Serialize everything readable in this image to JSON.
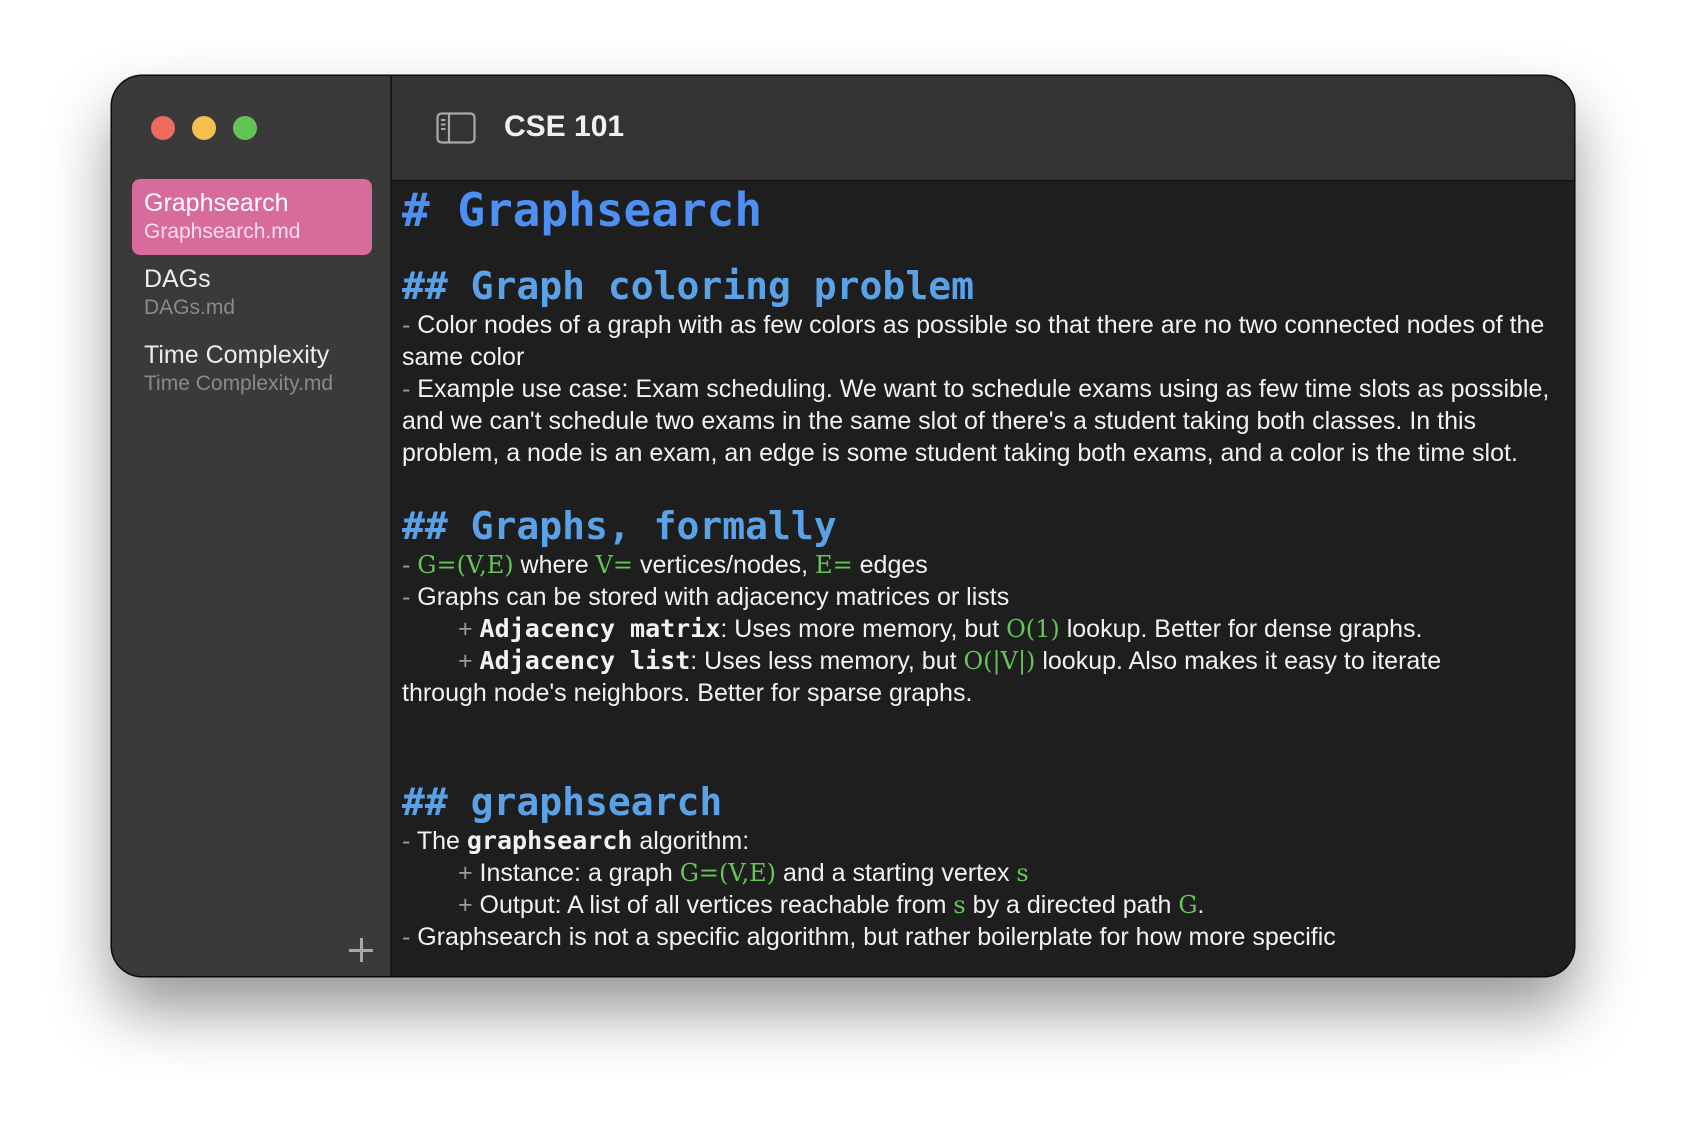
{
  "window": {
    "title": "CSE 101",
    "traffic_lights": [
      "close",
      "minimize",
      "zoom"
    ]
  },
  "sidebar": {
    "items": [
      {
        "title": "Graphsearch",
        "file": "Graphsearch.md",
        "selected": true
      },
      {
        "title": "DAGs",
        "file": "DAGs.md",
        "selected": false
      },
      {
        "title": "Time Complexity",
        "file": "Time Complexity.md",
        "selected": false
      }
    ],
    "add_icon": "plus-icon",
    "selected_color": "#d96a9c"
  },
  "toolbar": {
    "toggle_icon": "sidebar-toggle-icon"
  },
  "editor": {
    "h1": "# Graphsearch",
    "s1": {
      "heading": "## Graph coloring problem",
      "b1_marker": "-",
      "b1": " Color nodes of a graph with as few colors as possible so that there are no two connected nodes of the same color",
      "b2_marker": "-",
      "b2": " Example use case: Exam scheduling. We want to schedule exams using as few time slots as possible, and we can't schedule two exams in the same slot of there's a student taking both classes. In this problem, a node is an exam, an edge is some student taking both exams, and a color is the time slot."
    },
    "s2": {
      "heading": "## Graphs, formally",
      "l1_marker": "- ",
      "l1_math1": "G=(V,E)",
      "l1_t1": " where ",
      "l1_math2": "V=",
      "l1_t2": " vertices/nodes, ",
      "l1_math3": "E=",
      "l1_t3": " edges",
      "l2_marker": "-",
      "l2": " Graphs can be stored with adjacency matrices or lists",
      "l3_marker": "+ ",
      "l3_bold": "Adjacency matrix",
      "l3_t1": ": Uses more memory, but ",
      "l3_math": "O(1)",
      "l3_t2": " lookup. Better for dense graphs.",
      "l4_marker": "+ ",
      "l4_bold": "Adjacency list",
      "l4_t1": ": Uses less memory, but ",
      "l4_math": "O(|V|)",
      "l4_t2": " lookup. Also makes it easy to iterate",
      "l5": "through node's neighbors. Better for sparse graphs."
    },
    "s3": {
      "heading": "## graphsearch",
      "l1_marker": "-",
      "l1_t1": " The ",
      "l1_bold": "graphsearch",
      "l1_t2": " algorithm:",
      "l2_marker": "+",
      "l2_t1": " Instance: a graph ",
      "l2_math1": "G=(V,E)",
      "l2_t2": " and a starting vertex ",
      "l2_math2": "s",
      "l3_marker": "+",
      "l3_t1": " Output: A list of all vertices reachable from ",
      "l3_math1": "s",
      "l3_t2": " by a directed path ",
      "l3_math2": "G",
      "l3_t3": ".",
      "l4_marker": "-",
      "l4": " Graphsearch is not a specific algorithm, but rather boilerplate for how more specific"
    }
  },
  "colors": {
    "heading1": "#4d8ff2",
    "heading2": "#5aa2e8",
    "math": "#62c754",
    "editor_bg": "#1e1e1e",
    "sidebar_bg": "#3a3a3a"
  }
}
